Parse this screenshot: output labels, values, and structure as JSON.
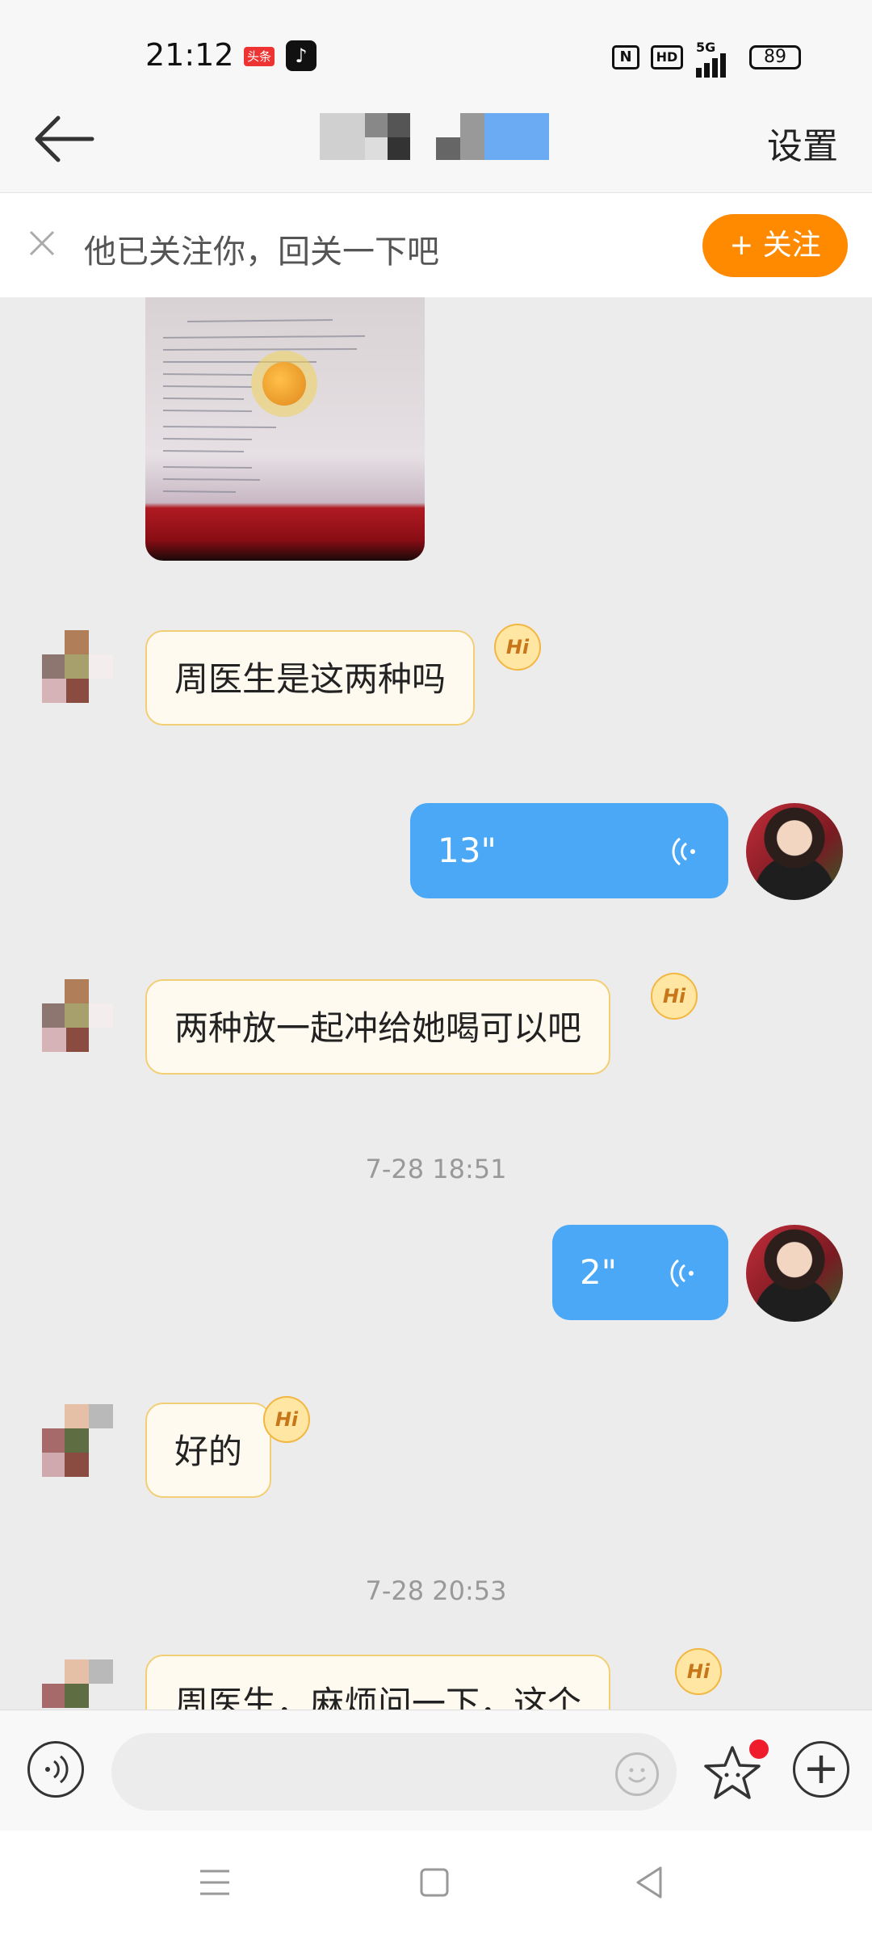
{
  "status_bar": {
    "time": "21:12",
    "toutiao_badge": "头条",
    "hd_label": "HD",
    "network_label": "5G",
    "battery": "89"
  },
  "header": {
    "settings_label": "设置"
  },
  "follow_bar": {
    "text": "他已关注你，回关一下吧",
    "button_label": "+ 关注"
  },
  "messages": [
    {
      "type": "image"
    },
    {
      "type": "text",
      "direction": "in",
      "text": "周医生是这两种吗",
      "badge": "Hi"
    },
    {
      "type": "voice",
      "direction": "out",
      "duration": "13\""
    },
    {
      "type": "text",
      "direction": "in",
      "text": "两种放一起冲给她喝可以吧",
      "badge": "Hi"
    },
    {
      "type": "timestamp",
      "text": "7-28 18:51"
    },
    {
      "type": "voice",
      "direction": "out",
      "duration": "2\""
    },
    {
      "type": "text",
      "direction": "in",
      "text": "好的",
      "badge": "Hi"
    },
    {
      "type": "timestamp",
      "text": "7-28 20:53"
    },
    {
      "type": "text",
      "direction": "in",
      "text": "周医生，麻烦问一下，这个",
      "badge": "Hi"
    }
  ],
  "input_bar": {
    "placeholder": ""
  },
  "colors": {
    "follow_button": "#ff8a00",
    "outgoing_bubble": "#4aa8f7",
    "incoming_bubble": "#fffaf0",
    "incoming_border": "#f2cf74",
    "notification_dot": "#ef1d2c"
  },
  "icons": [
    "back-arrow-icon",
    "close-icon",
    "voice-wave-icon",
    "voice-input-icon",
    "emoji-icon",
    "sticker-star-icon",
    "plus-icon",
    "menu-icon",
    "home-square-icon",
    "back-triangle-icon"
  ]
}
